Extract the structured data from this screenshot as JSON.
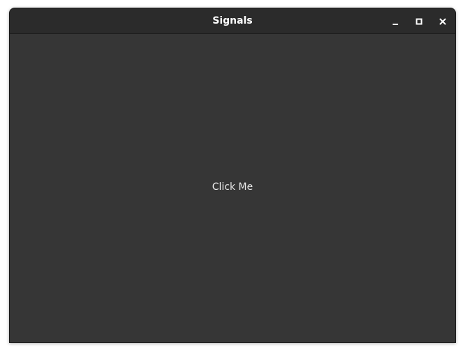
{
  "window": {
    "title": "Signals",
    "controls": {
      "minimize_icon": "minimize-icon",
      "maximize_icon": "maximize-icon",
      "close_icon": "close-icon"
    }
  },
  "content": {
    "button_label": "Click Me"
  },
  "colors": {
    "titlebar": "#2b2b2b",
    "background": "#363636",
    "text": "#e8e8e8"
  }
}
